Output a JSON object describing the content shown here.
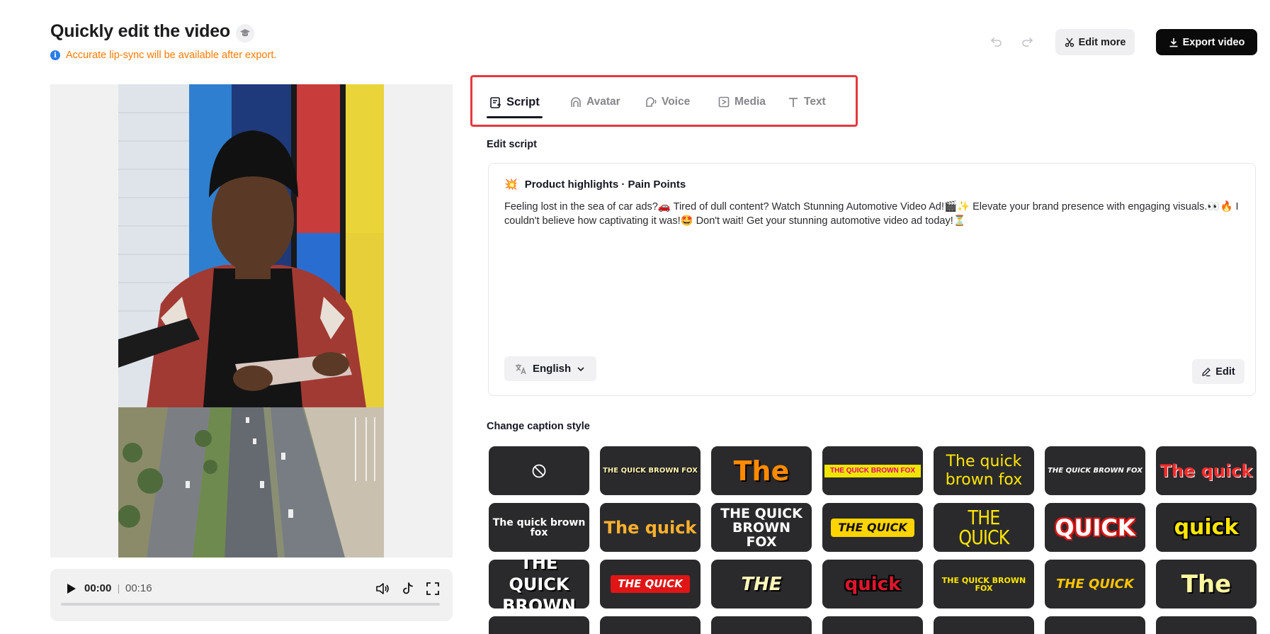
{
  "header": {
    "title": "Quickly edit the video",
    "title_badge_icon": "graduation-cap-icon",
    "notice": "Accurate lip-sync will be available after export.",
    "notice_icon": "info-icon",
    "edit_more_label": "Edit more",
    "export_label": "Export video"
  },
  "player": {
    "current_time": "00:00",
    "duration": "00:16",
    "progress": 0
  },
  "tabs": [
    {
      "label": "Script",
      "icon": "script-icon",
      "active": true
    },
    {
      "label": "Avatar",
      "icon": "avatar-icon",
      "active": false
    },
    {
      "label": "Voice",
      "icon": "voice-icon",
      "active": false
    },
    {
      "label": "Media",
      "icon": "media-icon",
      "active": false
    },
    {
      "label": "Text",
      "icon": "text-icon",
      "active": false
    }
  ],
  "script": {
    "section_label": "Edit script",
    "heading_emoji": "💥",
    "heading": "Product highlights · Pain Points",
    "text": "Feeling lost in the sea of car ads?🚗 Tired of dull content? Watch Stunning Automotive Video Ad!🎬✨ Elevate your brand presence with engaging visuals.👀🔥 I couldn't believe how captivating it was!🤩 Don't wait! Get your stunning automotive video ad today!⏳",
    "language": "English",
    "edit_label": "Edit"
  },
  "captions": {
    "section_label": "Change caption style",
    "styles": [
      {
        "text": ""
      },
      {
        "text": "THE QUICK BROWN FOX"
      },
      {
        "text": "The"
      },
      {
        "text": "THE QUICK BROWN FOX"
      },
      {
        "text": "The quick brown fox"
      },
      {
        "text": "THE QUICK BROWN FOX"
      },
      {
        "text": "The quick"
      },
      {
        "text": "The quick brown fox"
      },
      {
        "text": "The quick"
      },
      {
        "text": "THE QUICK BROWN FOX"
      },
      {
        "text": "THE QUICK"
      },
      {
        "text": "THE QUICK"
      },
      {
        "text": "QUICK"
      },
      {
        "text": "quick"
      },
      {
        "text": "THE QUICK BROWN"
      },
      {
        "text": "THE QUICK"
      },
      {
        "text": "THE"
      },
      {
        "text": "quick"
      },
      {
        "text": "THE QUICK BROWN FOX"
      },
      {
        "text": "THE QUICK"
      },
      {
        "text": "The"
      }
    ]
  }
}
